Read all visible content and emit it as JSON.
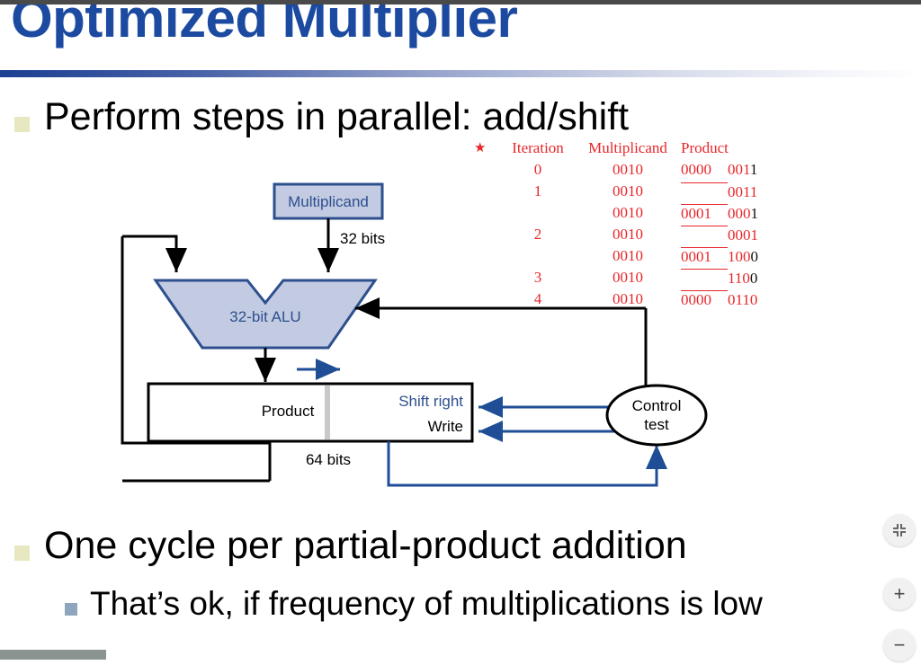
{
  "slide": {
    "title": "Optimized Multiplier",
    "bullets": [
      {
        "level": 1,
        "text": "Perform steps in parallel: add/shift",
        "marker": "square-khaki"
      },
      {
        "level": 1,
        "text": "One cycle per partial-product addition",
        "marker": "square-khaki"
      },
      {
        "level": 2,
        "text": "That’s ok, if frequency of multiplications is low",
        "marker": "square-bluegray"
      }
    ]
  },
  "iteration_table": {
    "star": "★",
    "headers": [
      "Iteration",
      "Multiplicand",
      "Product"
    ],
    "rows": [
      {
        "iteration": "0",
        "multiplicand": "0010",
        "product_hi": "0000",
        "product_lo": "0011",
        "lo_last_black": true,
        "hi_blank": false,
        "hi_rule": false
      },
      {
        "iteration": "1",
        "multiplicand": "0010",
        "product_hi": "",
        "product_lo": "0011",
        "lo_last_black": false,
        "hi_blank": true,
        "hi_rule": false
      },
      {
        "iteration": "",
        "multiplicand": "0010",
        "product_hi": "0001",
        "product_lo": "0001",
        "lo_last_black": true,
        "hi_blank": false,
        "hi_rule": true
      },
      {
        "iteration": "2",
        "multiplicand": "0010",
        "product_hi": "",
        "product_lo": "0001",
        "lo_last_black": false,
        "hi_blank": true,
        "hi_rule": false
      },
      {
        "iteration": "",
        "multiplicand": "0010",
        "product_hi": "0001",
        "product_lo": "1000",
        "lo_last_black": true,
        "hi_blank": false,
        "hi_rule": true
      },
      {
        "iteration": "3",
        "multiplicand": "0010",
        "product_hi": "",
        "product_lo": "1100",
        "lo_last_black": true,
        "hi_blank": true,
        "hi_rule": false
      },
      {
        "iteration": "4",
        "multiplicand": "0010",
        "product_hi": "0000",
        "product_lo": "0110",
        "lo_last_black": false,
        "hi_blank": false,
        "hi_rule": true
      }
    ],
    "color": "#e8262a"
  },
  "diagram": {
    "multiplicand_box": "Multiplicand",
    "multiplicand_width": "32 bits",
    "alu": "32-bit ALU",
    "product_register": "Product",
    "product_width": "64 bits",
    "shift_right": "Shift right",
    "write": "Write",
    "control": {
      "line1": "Control",
      "line2": "test"
    },
    "colors": {
      "box_fill": "#c3cbe2",
      "box_stroke": "#2d4f8e",
      "wire_black": "#000000",
      "wire_blue": "#1f4e96",
      "label_blue": "#2d4f8e"
    }
  },
  "zoom_controls": {
    "fit": {
      "icon": "fit-screen-icon",
      "label": ""
    },
    "zoom_in": {
      "icon": "plus-icon",
      "label": "+"
    },
    "zoom_out": {
      "icon": "minus-icon",
      "label": "−"
    }
  }
}
